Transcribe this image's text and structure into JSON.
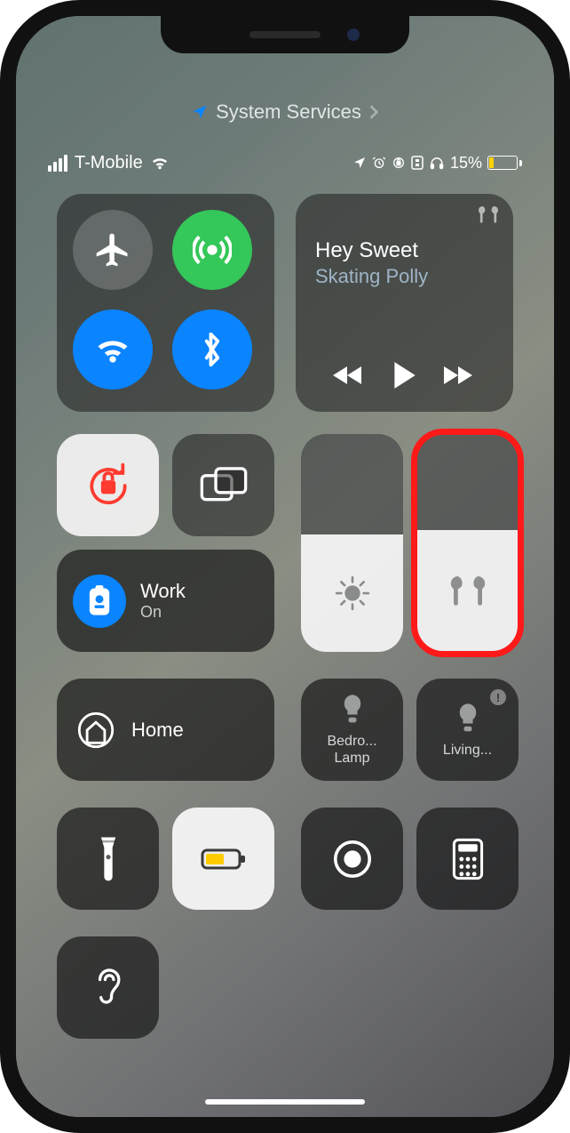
{
  "breadcrumb": {
    "label": "System Services"
  },
  "status": {
    "carrier": "T-Mobile",
    "battery_pct": "15%"
  },
  "media": {
    "title": "Hey Sweet",
    "artist": "Skating Polly"
  },
  "focus": {
    "name": "Work",
    "state": "On"
  },
  "home": {
    "label": "Home"
  },
  "accessories": {
    "bedroom": "Bedro...\nLamp",
    "living": "Living..."
  },
  "brightness_pct": 54,
  "volume_pct": 56,
  "annotations": {
    "volume_highlighted": true
  }
}
